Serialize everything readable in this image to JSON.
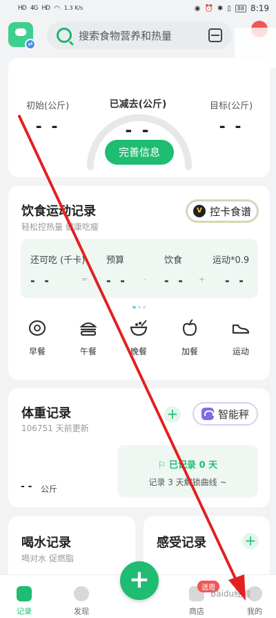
{
  "status_bar": {
    "net1": "HD",
    "net2": "HD",
    "signal": "4G",
    "speed": "1.3\nK/s",
    "battery": "88",
    "time": "8:19"
  },
  "search": {
    "placeholder": "搜索食物营养和热量"
  },
  "weight_summary": {
    "initial_label": "初始(公斤)",
    "initial_value": "- -",
    "lost_label": "已减去(公斤)",
    "lost_value": "- -",
    "target_label": "目标(公斤)",
    "target_value": "- -",
    "complete_button": "完善信息"
  },
  "diet_record": {
    "title": "饮食运动记录",
    "subtitle": "轻松控热量 健康吃瘦",
    "kakong_button": "控卡食谱",
    "kakong_logo_text": "V",
    "budget": [
      {
        "label": "还可吃 (千卡)",
        "value": "- -"
      },
      {
        "label": "预算",
        "value": "- -"
      },
      {
        "label": "饮食",
        "value": "- -"
      },
      {
        "label": "运动*0.9",
        "value": "- -"
      }
    ],
    "ops": [
      "=",
      "-",
      "+"
    ],
    "meals": [
      {
        "label": "早餐",
        "icon": "egg-icon"
      },
      {
        "label": "午餐",
        "icon": "burger-icon"
      },
      {
        "label": "晚餐",
        "icon": "bowl-icon"
      },
      {
        "label": "加餐",
        "icon": "apple-icon"
      },
      {
        "label": "运动",
        "icon": "shoe-icon"
      }
    ]
  },
  "weight_record": {
    "title": "体重记录",
    "updated": "106751 天前更新",
    "plus": "+",
    "scale_button": "智能秤",
    "stat_line1": "已记录 0 天",
    "stat_line2": "记录 3 天解锁曲线 ~",
    "value": "- -",
    "unit": "公斤"
  },
  "water_record": {
    "title": "喝水记录",
    "subtitle": "喝对水 促燃脂"
  },
  "feel_record": {
    "title": "感受记录",
    "plus": "+"
  },
  "bottom_nav": {
    "record": "记录",
    "discover": "发现",
    "fab": "+",
    "shop": "商店",
    "mine": "我的",
    "promo": "送周",
    "watermark": "Baidu经验"
  },
  "colors": {
    "accent": "#1fbd72",
    "arrow": "#e32020",
    "badge": "#f25555"
  }
}
